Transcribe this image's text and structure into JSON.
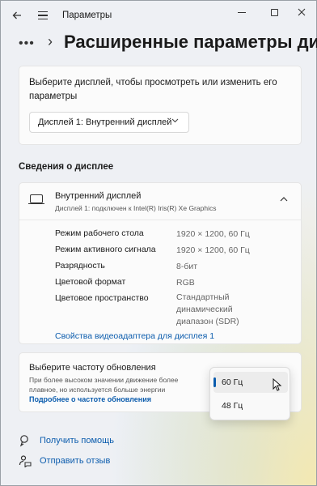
{
  "window": {
    "title": "Параметры",
    "accent": "#0b5cad"
  },
  "header": {
    "overflow_label": "•••",
    "title": "Расширенные параметры дисплея"
  },
  "display_select": {
    "prompt": "Выберите дисплей, чтобы просмотреть или изменить его параметры",
    "selected": "Дисплей 1: Внутренний дисплей"
  },
  "display_info": {
    "section_title": "Сведения о дисплее",
    "name": "Внутренний дисплей",
    "subtitle": "Дисплей 1: подключен к Intel(R) Iris(R) Xe Graphics",
    "rows": [
      {
        "label": "Режим рабочего стола",
        "value": "1920 × 1200, 60 Гц"
      },
      {
        "label": "Режим активного сигнала",
        "value": "1920 × 1200, 60 Гц"
      },
      {
        "label": "Разрядность",
        "value": "8-бит"
      },
      {
        "label": "Цветовой формат",
        "value": "RGB"
      },
      {
        "label": "Цветовое пространство",
        "value": "Стандартный динамический диапазон (SDR)"
      }
    ],
    "adapter_link": "Свойства видеоадаптера для дисплея 1"
  },
  "refresh": {
    "title": "Выберите частоту обновления",
    "description": "При более высоком значении движение более плавное, но используется больше энергии",
    "link": "Подробнее о частоте обновления",
    "options": [
      "60 Гц",
      "48 Гц"
    ],
    "selected": "60 Гц"
  },
  "footer": {
    "help": "Получить помощь",
    "feedback": "Отправить отзыв"
  },
  "icons": {
    "back": "back-arrow-icon",
    "menu": "hamburger-menu-icon",
    "minimize": "minimize-icon",
    "maximize": "maximize-icon",
    "close": "close-icon",
    "monitor": "monitor-icon",
    "help": "help-icon",
    "feedback": "feedback-icon",
    "cursor": "mouse-cursor-icon"
  }
}
